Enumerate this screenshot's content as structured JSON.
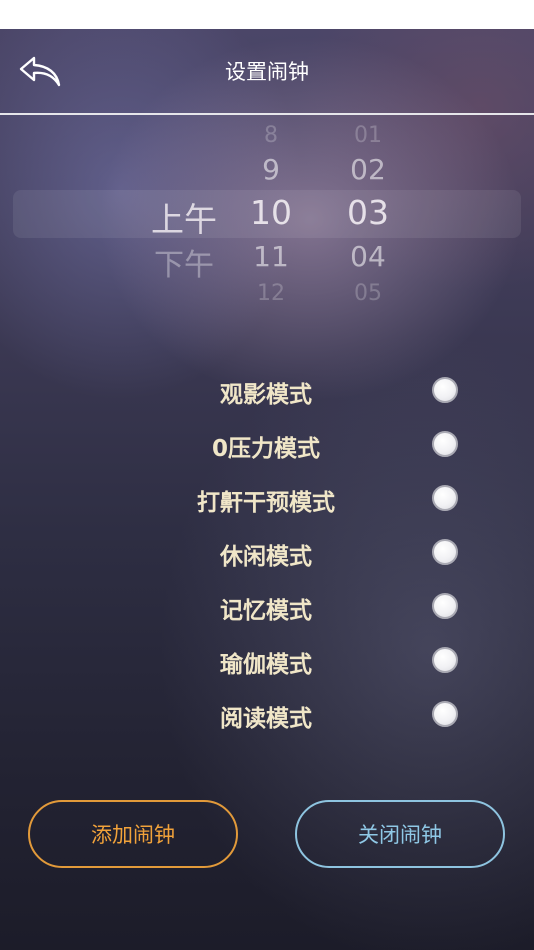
{
  "header": {
    "title": "设置闹钟",
    "back_icon": "back-arrow-icon"
  },
  "picker": {
    "ampm": {
      "above": "",
      "selected": "上午",
      "below": "下午"
    },
    "hours": {
      "far_above": "8",
      "above": "9",
      "selected": "10",
      "below": "11",
      "far_below": "12"
    },
    "minutes": {
      "far_above": "01",
      "above": "02",
      "selected": "03",
      "below": "04",
      "far_below": "05"
    }
  },
  "modes": [
    {
      "label": "观影模式",
      "selected": false
    },
    {
      "label": "0压力模式",
      "selected": false
    },
    {
      "label": "打鼾干预模式",
      "selected": false
    },
    {
      "label": "休闲模式",
      "selected": false
    },
    {
      "label": "记忆模式",
      "selected": false
    },
    {
      "label": "瑜伽模式",
      "selected": false
    },
    {
      "label": "阅读模式",
      "selected": false
    }
  ],
  "buttons": {
    "add_label": "添加闹钟",
    "close_label": "关闭闹钟"
  },
  "colors": {
    "add_accent": "#e29a3a",
    "close_accent": "#8ec4e0",
    "mode_text": "#f0e6c8"
  }
}
